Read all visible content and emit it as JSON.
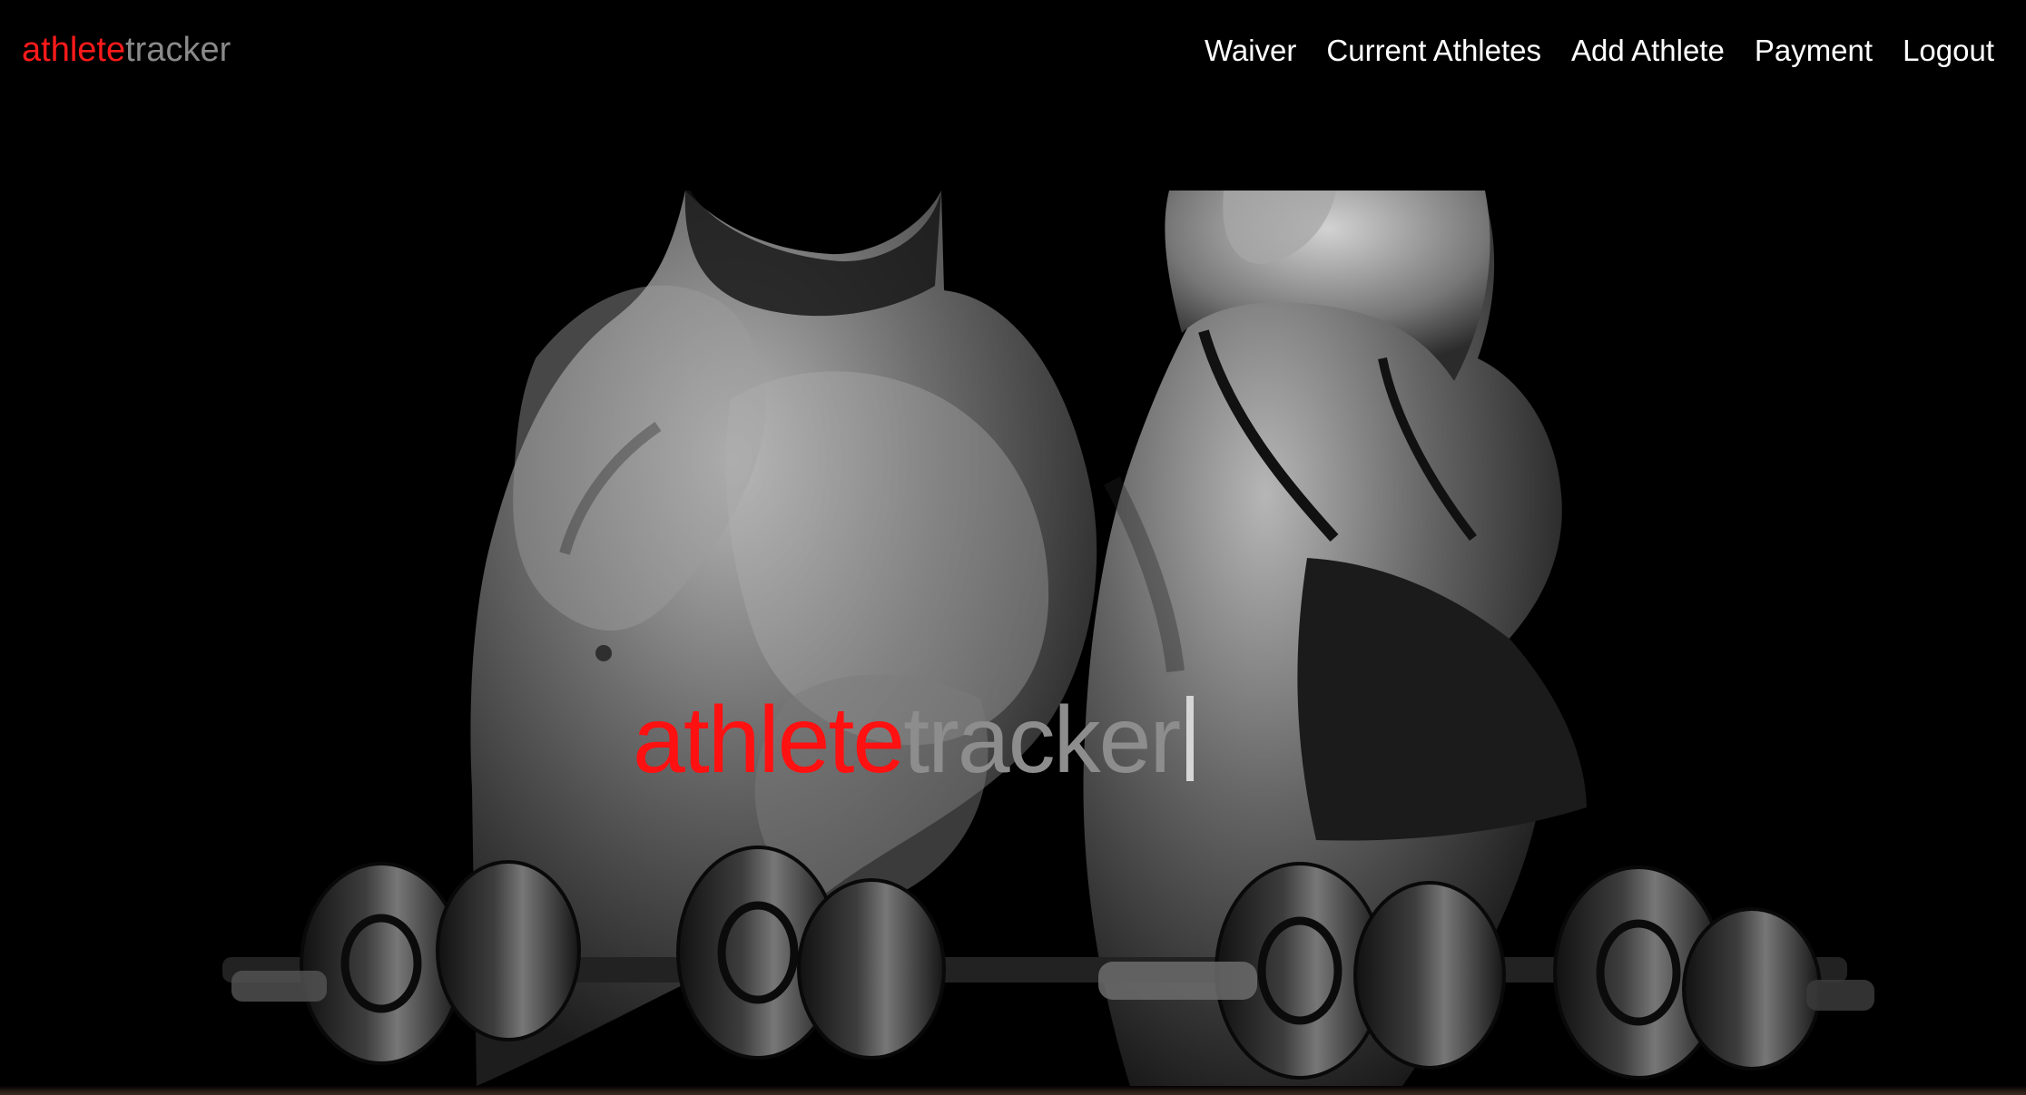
{
  "brand": {
    "part_a": "athlete",
    "part_b": "tracker"
  },
  "nav": {
    "items": [
      {
        "label": "Waiver"
      },
      {
        "label": "Current Athletes"
      },
      {
        "label": "Add Athlete"
      },
      {
        "label": "Payment"
      },
      {
        "label": "Logout"
      }
    ]
  },
  "hero": {
    "title_a": "athlete",
    "title_b": "tracker"
  },
  "colors": {
    "accent_red": "#ff1a1a",
    "brand_gray": "#8a8a8a",
    "background": "#000000",
    "nav_text": "#ffffff"
  }
}
